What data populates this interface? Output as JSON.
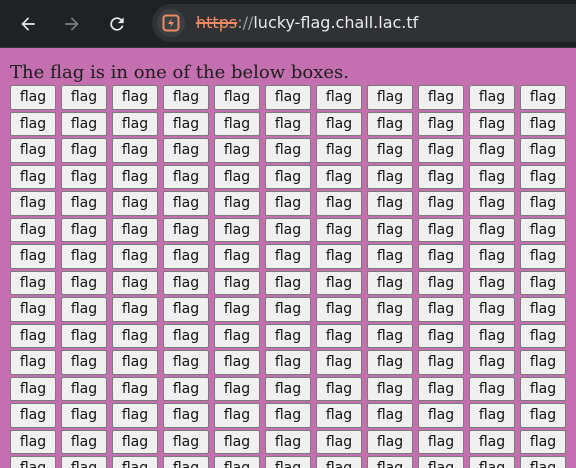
{
  "browser": {
    "url_scheme": "https",
    "url_separator": "://",
    "url_host": "lucky-flag.chall.lac.tf",
    "icons": {
      "back": "arrow-left-icon",
      "forward": "arrow-right-icon",
      "reload": "reload-icon",
      "security": "not-secure-site-icon"
    }
  },
  "page": {
    "intro_text": "The flag is in one of the below boxes.",
    "button_label": "flag",
    "visible_rows": 15,
    "columns": 11
  },
  "colors": {
    "page_background": "#c46faf",
    "toolbar_background": "#202124",
    "omnibox_background": "#303134",
    "security_warning": "#f28b63",
    "button_background": "#f0f0f0",
    "button_border": "#7b7b7b"
  }
}
